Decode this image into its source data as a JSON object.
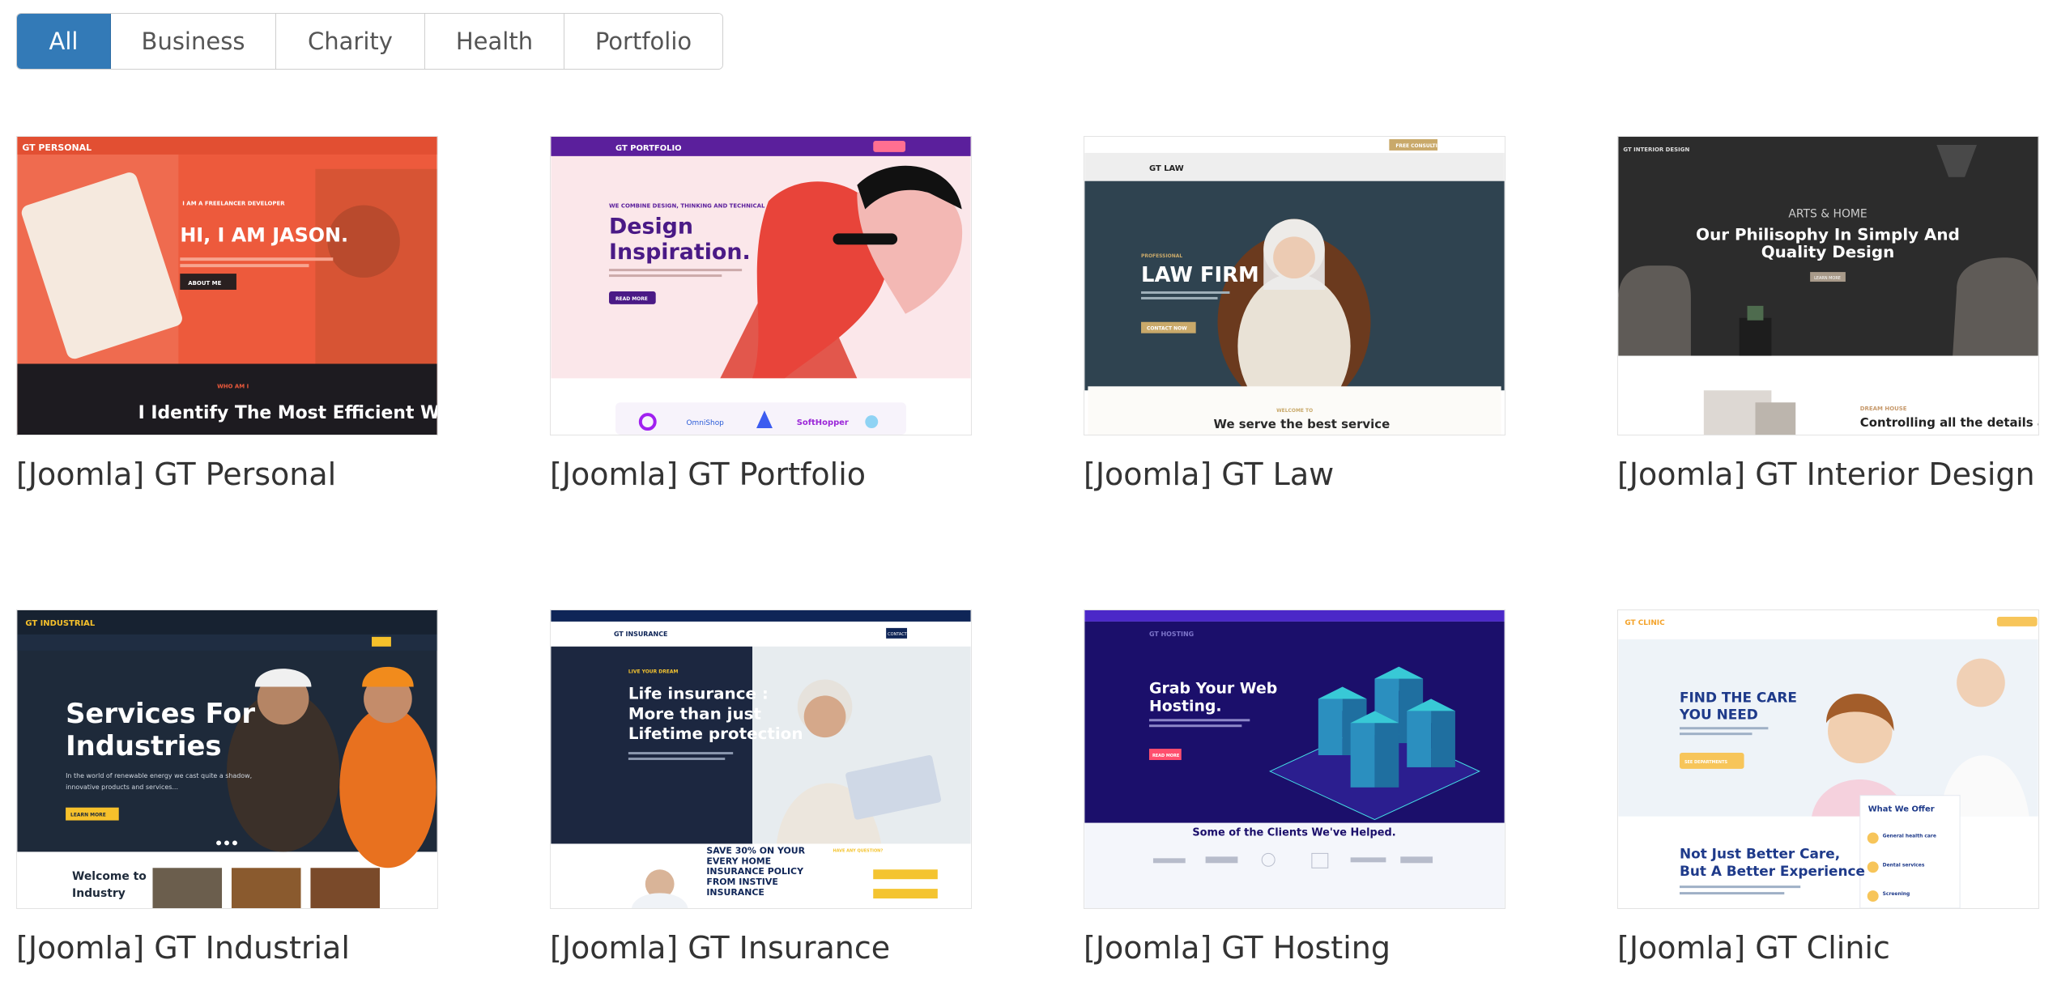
{
  "filters": [
    {
      "label": "All",
      "active": true
    },
    {
      "label": "Business",
      "active": false
    },
    {
      "label": "Charity",
      "active": false
    },
    {
      "label": "Health",
      "active": false
    },
    {
      "label": "Portfolio",
      "active": false
    }
  ],
  "templates": [
    {
      "title": "[Joomla] GT Personal",
      "preview": {
        "logo": "GT PERSONAL",
        "kicker": "I AM A FREELANCER DEVELOPER",
        "headline": "HI, I AM JASON.",
        "button": "ABOUT ME",
        "lower_kicker": "WHO AM I",
        "lower_headline": "I Identify The Most Efficient Ways To"
      }
    },
    {
      "title": "[Joomla] GT Portfolio",
      "preview": {
        "logo": "GT PORTFOLIO",
        "kicker": "WE COMBINE DESIGN, THINKING AND TECHNICAL",
        "headline_line1": "Design",
        "headline_line2": "Inspiration.",
        "button": "READ MORE",
        "partner_labels": [
          "OmniShop",
          "SoftHopper"
        ]
      }
    },
    {
      "title": "[Joomla] GT Law",
      "preview": {
        "logo": "GT LAW",
        "kicker": "PROFESSIONAL",
        "headline": "LAW FIRM",
        "button": "CONTACT NOW",
        "top_button": "FREE CONSULTING",
        "lower_kicker": "WELCOME TO",
        "lower_headline": "We serve the best service"
      }
    },
    {
      "title": "[Joomla] GT Interior Design",
      "preview": {
        "logo": "GT INTERIOR DESIGN",
        "kicker": "ARTS & HOME",
        "headline_line1": "Our Philisophy In Simply And",
        "headline_line2": "Quality Design",
        "button": "LEARN MORE",
        "lower_kicker": "DREAM HOUSE",
        "lower_headline": "Controlling all the details and consulting"
      }
    },
    {
      "title": "[Joomla] GT Industrial",
      "preview": {
        "logo": "GT INDUSTRIAL",
        "headline_line1": "Services For",
        "headline_line2": "Industries",
        "subtext_line1": "In the world of renewable energy we cast quite a shadow,",
        "subtext_line2": "innovative products and services...",
        "button": "LEARN MORE",
        "lower_headline_line1": "Welcome to",
        "lower_headline_line2": "Industry"
      }
    },
    {
      "title": "[Joomla] GT Insurance",
      "preview": {
        "logo": "GT INSURANCE",
        "kicker": "LIVE YOUR DREAM",
        "headline_line1": "Life insurance :",
        "headline_line2": "More than just",
        "headline_line3": "Lifetime protection",
        "nav_button": "CONTACT",
        "promo_line1": "SAVE 30% ON YOUR",
        "promo_line2": "EVERY HOME",
        "promo_line3": "INSURANCE POLICY",
        "promo_line4": "FROM INSTIVE",
        "promo_line5": "INSURANCE",
        "side_kicker": "HAVE ANY QUESTION?"
      }
    },
    {
      "title": "[Joomla] GT Hosting",
      "preview": {
        "logo": "GT HOSTING",
        "headline_line1": "Grab Your Web",
        "headline_line2": "Hosting.",
        "button": "READ MORE",
        "lower_headline": "Some of the Clients We've Helped."
      }
    },
    {
      "title": "[Joomla] GT Clinic",
      "preview": {
        "logo": "GT CLINIC",
        "headline_line1": "FIND THE CARE",
        "headline_line2": "YOU NEED",
        "button": "SEE DEPARTMENTS",
        "card_title": "What We Offer",
        "card_items": [
          "General health care",
          "Dental services",
          "Screening"
        ],
        "lower_headline_line1": "Not Just Better Care,",
        "lower_headline_line2": "But A Better Experience"
      }
    }
  ],
  "colors": {
    "active_filter": "#337ab7",
    "personal": "#ed5a3c",
    "portfolio": "#5b1f9c",
    "law_accent": "#c9a96a",
    "interior": "#2c2c2c",
    "industrial_accent": "#f6c12b",
    "insurance": "#0f2557",
    "hosting": "#1b0f6b",
    "clinic": "#1e3a8a"
  }
}
